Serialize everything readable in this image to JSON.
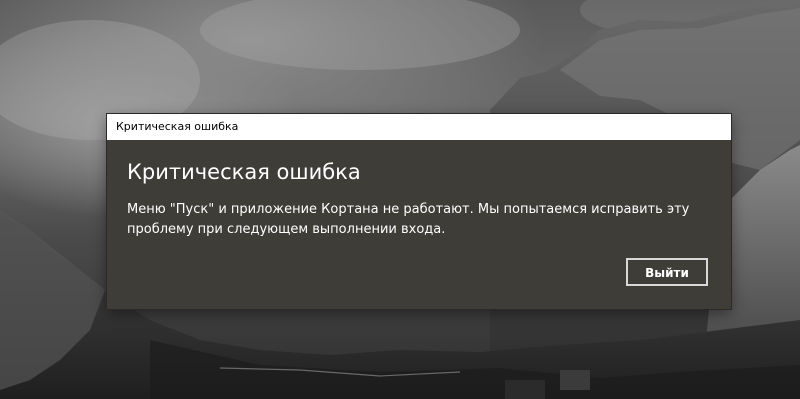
{
  "window": {
    "title": "Критическая ошибка"
  },
  "dialog": {
    "heading": "Критическая ошибка",
    "message": "Меню \"Пуск\" и приложение Кортана не работают. Мы попытаемся исправить эту проблему при следующем выполнении входа.",
    "exit_label": "Выйти"
  },
  "colors": {
    "dialog_background": "#3f3d38",
    "titlebar_background": "#ffffff",
    "text": "#ffffff",
    "button_border": "#d8d8d8"
  }
}
